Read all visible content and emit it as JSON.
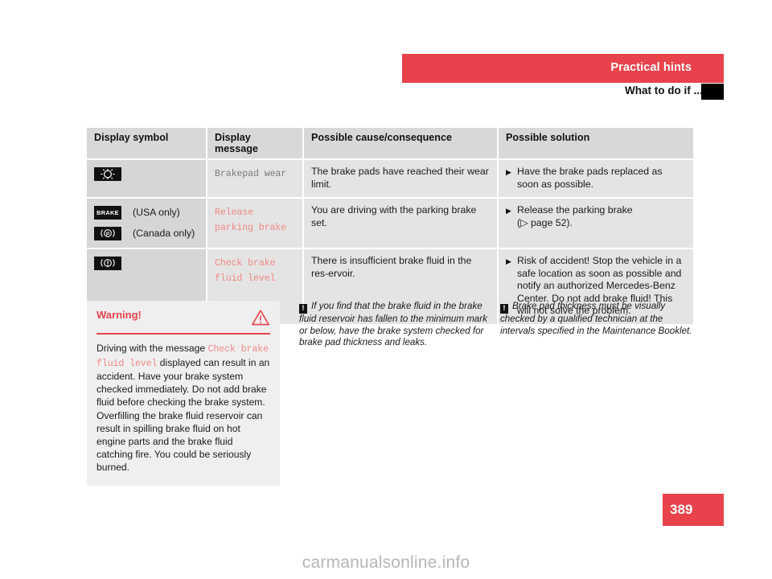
{
  "header": {
    "section_title": "Practical hints",
    "subsection_title": "What to do if ...?"
  },
  "table": {
    "columns": [
      "Display symbol",
      "Display message",
      "Possible cause/consequence",
      "Possible solution"
    ],
    "rows": [
      {
        "symbols": [
          {
            "icon": "brake-pad-wear-icon",
            "glyph": "☀",
            "note": ""
          }
        ],
        "message": "Brakepad wear",
        "message_color": "gray",
        "cause": "The brake pads have reached their wear limit.",
        "solution_marker": "▶",
        "solution": "Have the brake pads replaced as soon as possible."
      },
      {
        "symbols": [
          {
            "icon": "brake-warning-icon",
            "glyph": "BRAKE",
            "note": "(USA only)"
          },
          {
            "icon": "parking-brake-p-icon",
            "glyph": "Ⓟ",
            "note": "(Canada only)"
          }
        ],
        "message": "Release parking brake",
        "message_color": "red",
        "cause": "You are driving with the parking brake set.",
        "solution_marker": "▶",
        "solution": "Release the parking brake",
        "solution_ref": "(▷ page 52)."
      },
      {
        "symbols": [
          {
            "icon": "brake-fluid-warning-icon",
            "glyph": "((!))",
            "note": ""
          }
        ],
        "message": "Check brake fluid level",
        "message_color": "red",
        "cause": "There is insufficient brake fluid in the res-ervoir.",
        "solution_marker": "▶",
        "solution": "Risk of accident! Stop the vehicle in a safe location as soon as possible and notify an authorized Mercedes-Benz Center. Do not add brake fluid! This will not solve the problem."
      }
    ]
  },
  "warning": {
    "title": "Warning!",
    "icon": "warning-triangle-icon",
    "text_part1": "Driving with the message ",
    "text_mono": "Check brake fluid level",
    "text_part2": " displayed can result in an accident. Have your brake system checked immediately. Do not add brake fluid before checking the brake system. Overfilling the brake fluid reservoir can result in spilling brake fluid on hot engine parts and the brake fluid catching fire. You could be seriously burned."
  },
  "notes": [
    {
      "icon": "info-exclamation-icon",
      "icon_glyph": "!",
      "text": "If you find that the brake fluid in the brake fluid reservoir has fallen to the minimum mark or below, have the brake system checked for brake pad thickness and leaks."
    },
    {
      "icon": "info-exclamation-icon",
      "icon_glyph": "!",
      "text": "Brake pad thickness must be visually checked by a qualified technician at the intervals specified in the Maintenance Booklet."
    }
  ],
  "page_number": "389",
  "watermark": "carmanualsonline.info",
  "colors": {
    "accent_red": "#e8434b",
    "message_red": "#f08a86",
    "message_gray": "#7a7a7a",
    "table_bg": "#e4e4e4",
    "symbol_col_bg": "#d6d6d6",
    "header_row_bg": "#d8d8d8",
    "warning_box_bg": "#efefef"
  }
}
